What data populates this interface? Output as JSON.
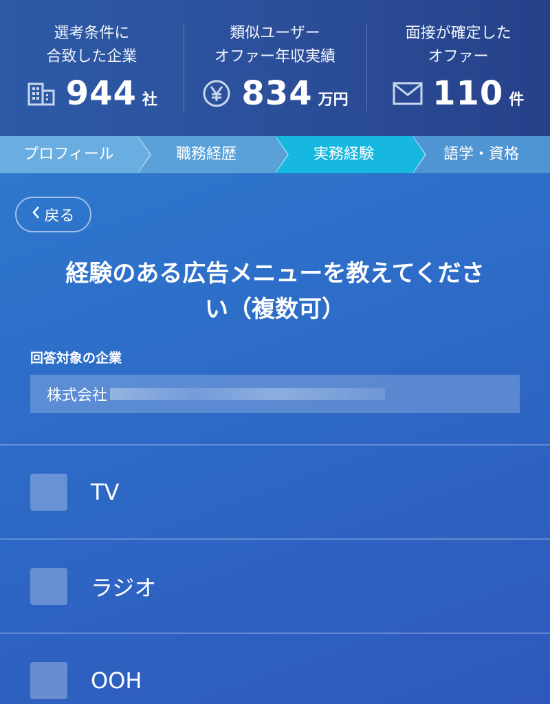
{
  "stats": [
    {
      "title_line1": "選考条件に",
      "title_line2": "合致した企業",
      "value": "944",
      "unit": "社",
      "icon": "building-icon"
    },
    {
      "title_line1": "類似ユーザー",
      "title_line2": "オファー年収実績",
      "value": "834",
      "unit": "万円",
      "icon": "yen-icon"
    },
    {
      "title_line1": "面接が確定した",
      "title_line2": "オファー",
      "value": "110",
      "unit": "件",
      "icon": "mail-icon"
    }
  ],
  "steps": [
    {
      "label": "プロフィール",
      "active": false
    },
    {
      "label": "職務経歴",
      "active": false
    },
    {
      "label": "実務経験",
      "active": true
    },
    {
      "label": "語学・資格",
      "active": false
    }
  ],
  "back": {
    "label": "戻る"
  },
  "question": {
    "line1": "経験のある広告メニューを教えてくださ",
    "line2": "い（複数可）"
  },
  "target": {
    "label": "回答対象の企業",
    "company_prefix": "株式会社"
  },
  "options": [
    {
      "label": "TV",
      "checked": false
    },
    {
      "label": "ラジオ",
      "checked": false
    },
    {
      "label": "OOH",
      "checked": false
    }
  ],
  "colors": {
    "active_step": "#16b8e0",
    "header_bg": "#2c4f9a"
  }
}
